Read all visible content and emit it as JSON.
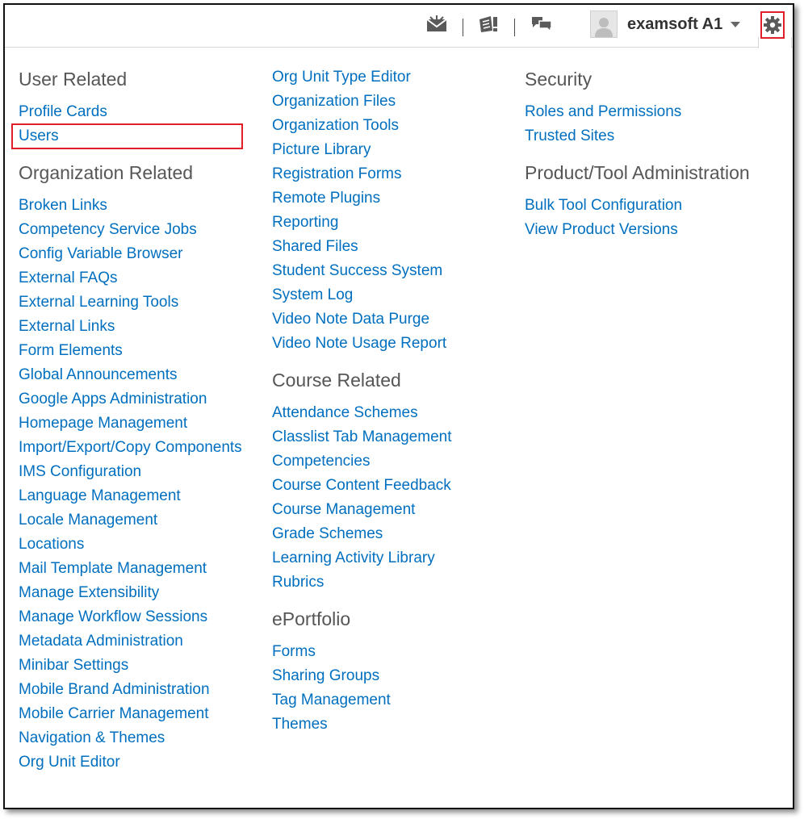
{
  "header": {
    "user_name": "examsoft A1",
    "icons": [
      "mail-icon",
      "updates-icon",
      "chat-icon",
      "avatar-icon",
      "gear-icon"
    ]
  },
  "columns": [
    {
      "sections": [
        {
          "heading": "User Related",
          "items": [
            "Profile Cards",
            "Users"
          ]
        },
        {
          "heading": "Organization Related",
          "items": [
            "Broken Links",
            "Competency Service Jobs",
            "Config Variable Browser",
            "External FAQs",
            "External Learning Tools",
            "External Links",
            "Form Elements",
            "Global Announcements",
            "Google Apps Administration",
            "Homepage Management",
            "Import/Export/Copy Components",
            "IMS Configuration",
            "Language Management",
            "Locale Management",
            "Locations",
            "Mail Template Management",
            "Manage Extensibility",
            "Manage Workflow Sessions",
            "Metadata Administration",
            "Minibar Settings",
            "Mobile Brand Administration",
            "Mobile Carrier Management",
            "Navigation & Themes",
            "Org Unit Editor"
          ]
        }
      ]
    },
    {
      "sections": [
        {
          "heading": "",
          "items": [
            "Org Unit Type Editor",
            "Organization Files",
            "Organization Tools",
            "Picture Library",
            "Registration Forms",
            "Remote Plugins",
            "Reporting",
            "Shared Files",
            "Student Success System",
            "System Log",
            "Video Note Data Purge",
            "Video Note Usage Report"
          ]
        },
        {
          "heading": "Course Related",
          "items": [
            "Attendance Schemes",
            "Classlist Tab Management",
            "Competencies",
            "Course Content Feedback",
            "Course Management",
            "Grade Schemes",
            "Learning Activity Library",
            "Rubrics"
          ]
        },
        {
          "heading": "ePortfolio",
          "items": [
            "Forms",
            "Sharing Groups",
            "Tag Management",
            "Themes"
          ]
        }
      ]
    },
    {
      "sections": [
        {
          "heading": "Security",
          "items": [
            "Roles and Permissions",
            "Trusted Sites"
          ]
        },
        {
          "heading": "Product/Tool Administration",
          "items": [
            "Bulk Tool Configuration",
            "View Product Versions"
          ]
        }
      ]
    }
  ],
  "highlight": {
    "color": "#e01f26",
    "targets": [
      "Users",
      "gear-icon"
    ]
  },
  "colors": {
    "link": "#006fbf",
    "heading": "#565656",
    "highlight": "#e01f26"
  }
}
